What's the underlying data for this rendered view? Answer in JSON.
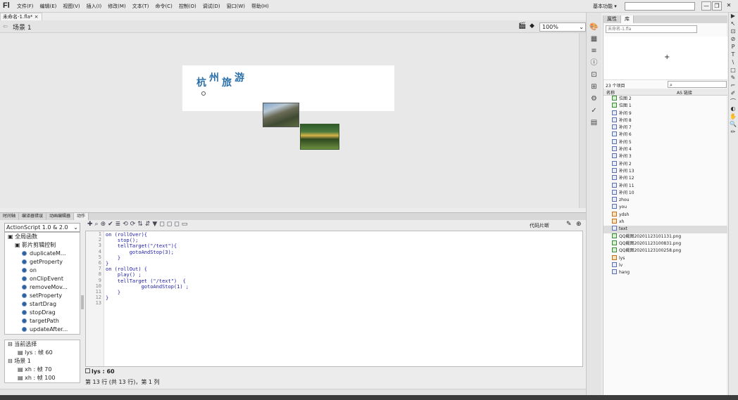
{
  "menubar": {
    "logo": "Fl",
    "items": [
      "文件(F)",
      "编辑(E)",
      "视图(V)",
      "插入(I)",
      "修改(M)",
      "文本(T)",
      "命令(C)",
      "控制(O)",
      "调试(D)",
      "窗口(W)",
      "帮助(H)"
    ],
    "workspace": "基本功能 ▾",
    "search_placeholder": "",
    "win_min": "—",
    "win_restore": "❐",
    "win_close": "✕"
  },
  "document": {
    "tab_label": "未命名-1.fla* ×",
    "scene_label": "场景 1",
    "zoom": "100%"
  },
  "stage": {
    "title_chars": [
      "杭",
      "州",
      "旅",
      "游"
    ]
  },
  "panels": {
    "tabs": [
      "时间轴",
      "编译器错误",
      "动画编辑器",
      "动作"
    ],
    "as_version": "ActionScript 1.0 & 2.0",
    "tree": [
      {
        "label": "全局函数",
        "level": 0,
        "type": "folder"
      },
      {
        "label": "影片剪辑控制",
        "level": 1,
        "type": "folder"
      },
      {
        "label": "duplicateM...",
        "level": 2,
        "type": "fn"
      },
      {
        "label": "getProperty",
        "level": 2,
        "type": "fn"
      },
      {
        "label": "on",
        "level": 2,
        "type": "fn"
      },
      {
        "label": "onClipEvent",
        "level": 2,
        "type": "fn"
      },
      {
        "label": "removeMov...",
        "level": 2,
        "type": "fn"
      },
      {
        "label": "setProperty",
        "level": 2,
        "type": "fn"
      },
      {
        "label": "startDrag",
        "level": 2,
        "type": "fn"
      },
      {
        "label": "stopDrag",
        "level": 2,
        "type": "fn"
      },
      {
        "label": "targetPath",
        "level": 2,
        "type": "fn"
      },
      {
        "label": "updateAfter...",
        "level": 2,
        "type": "fn"
      }
    ],
    "nav": [
      {
        "label": "当前选择",
        "level": 0
      },
      {
        "label": "lys : 帧 60",
        "level": 1
      },
      {
        "label": "场景 1",
        "level": 0
      },
      {
        "label": "xh : 帧 70",
        "level": 1
      },
      {
        "label": "xh : 帧 100",
        "level": 1
      }
    ],
    "code_snippets_label": "代码片断",
    "code_lines": [
      "on (rollOver){",
      "    stop();",
      "    tellTarget(\"/text\"){",
      "        gotoAndStop(3);",
      "    }",
      "}",
      "on (rollOut) {",
      "    play() ;",
      "    tellTarget (\"/text\")  {",
      "            gotoAndStop(1) ;",
      "    }",
      "}",
      ""
    ],
    "line_numbers": [
      "1",
      "2",
      "3",
      "4",
      "5",
      "6",
      "7",
      "8",
      "9",
      "10",
      "11",
      "12",
      "13"
    ],
    "status_tab": "lys : 60",
    "status_line": "第 13 行 (共 13 行)，第 1 列"
  },
  "library": {
    "tabs": [
      "属性",
      "库"
    ],
    "doc": "未命名-1.fla",
    "preview_plus": "+",
    "count": "23 个项目",
    "col_name": "名称",
    "col_link": "AS 链接",
    "items": [
      {
        "label": "位图 2",
        "kind": "bmp"
      },
      {
        "label": "位图 1",
        "kind": "bmp"
      },
      {
        "label": "补间 9",
        "kind": "sym"
      },
      {
        "label": "补间 8",
        "kind": "sym"
      },
      {
        "label": "补间 7",
        "kind": "sym"
      },
      {
        "label": "补间 6",
        "kind": "sym"
      },
      {
        "label": "补间 5",
        "kind": "sym"
      },
      {
        "label": "补间 4",
        "kind": "sym"
      },
      {
        "label": "补间 3",
        "kind": "sym"
      },
      {
        "label": "补间 2",
        "kind": "sym"
      },
      {
        "label": "补间 13",
        "kind": "sym"
      },
      {
        "label": "补间 12",
        "kind": "sym"
      },
      {
        "label": "补间 11",
        "kind": "sym"
      },
      {
        "label": "补间 10",
        "kind": "sym"
      },
      {
        "label": "zhou",
        "kind": "sym"
      },
      {
        "label": "you",
        "kind": "sym"
      },
      {
        "label": "ydsh",
        "kind": "mc"
      },
      {
        "label": "xh",
        "kind": "mc"
      },
      {
        "label": "text",
        "kind": "sym",
        "selected": true
      },
      {
        "label": "QQ截图20201123101131.png",
        "kind": "bmp"
      },
      {
        "label": "QQ截图20201123100831.png",
        "kind": "bmp"
      },
      {
        "label": "QQ截图20201123100258.png",
        "kind": "bmp"
      },
      {
        "label": "lys",
        "kind": "mc"
      },
      {
        "label": "lv",
        "kind": "sym"
      },
      {
        "label": "hang",
        "kind": "sym"
      }
    ]
  },
  "tools": [
    "▶",
    "↖",
    "⊡",
    "⊘",
    "P",
    "T",
    "\\",
    "□",
    "✎",
    "⌐",
    "✐",
    "⌒",
    "◐",
    "✋",
    "🔍",
    "✏"
  ],
  "colors": {
    "accent": "#2a6fa8",
    "code": "#1a1aa6"
  }
}
